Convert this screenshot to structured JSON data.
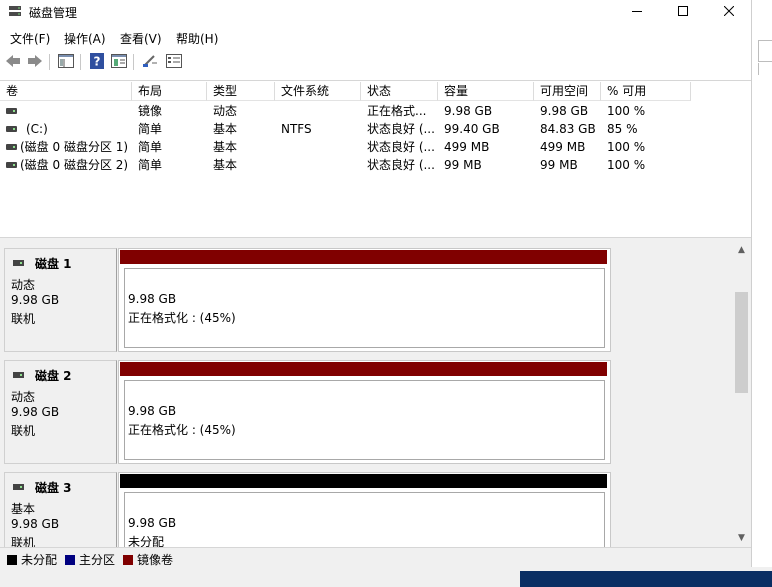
{
  "window": {
    "title": "磁盘管理"
  },
  "menu": [
    "文件(F)",
    "操作(A)",
    "查看(V)",
    "帮助(H)"
  ],
  "volume_list": {
    "columns": [
      "卷",
      "布局",
      "类型",
      "文件系统",
      "状态",
      "容量",
      "可用空间",
      "% 可用"
    ],
    "rows": [
      [
        "",
        "镜像",
        "动态",
        "",
        "正在格式...",
        "9.98 GB",
        "9.98 GB",
        "100 %"
      ],
      [
        "(C:)",
        "简单",
        "基本",
        "NTFS",
        "状态良好 (...",
        "99.40 GB",
        "84.83 GB",
        "85 %"
      ],
      [
        "(磁盘 0 磁盘分区 1)",
        "简单",
        "基本",
        "",
        "状态良好 (...",
        "499 MB",
        "499 MB",
        "100 %"
      ],
      [
        "(磁盘 0 磁盘分区 2)",
        "简单",
        "基本",
        "",
        "状态良好 (...",
        "99 MB",
        "99 MB",
        "100 %"
      ]
    ]
  },
  "disks": [
    {
      "name": "磁盘 1",
      "type": "动态",
      "size": "9.98 GB",
      "status": "联机",
      "partition_size": "9.98 GB",
      "partition_status": "正在格式化 : (45%)",
      "bar_color": "#800000"
    },
    {
      "name": "磁盘 2",
      "type": "动态",
      "size": "9.98 GB",
      "status": "联机",
      "partition_size": "9.98 GB",
      "partition_status": "正在格式化 : (45%)",
      "bar_color": "#800000"
    },
    {
      "name": "磁盘 3",
      "type": "基本",
      "size": "9.98 GB",
      "status": "联机",
      "partition_size": "9.98 GB",
      "partition_status": "未分配",
      "bar_color": "#000000"
    }
  ],
  "legend": [
    {
      "label": "未分配",
      "color": "#000000"
    },
    {
      "label": "主分区",
      "color": "#000080"
    },
    {
      "label": "镜像卷",
      "color": "#800000"
    }
  ]
}
